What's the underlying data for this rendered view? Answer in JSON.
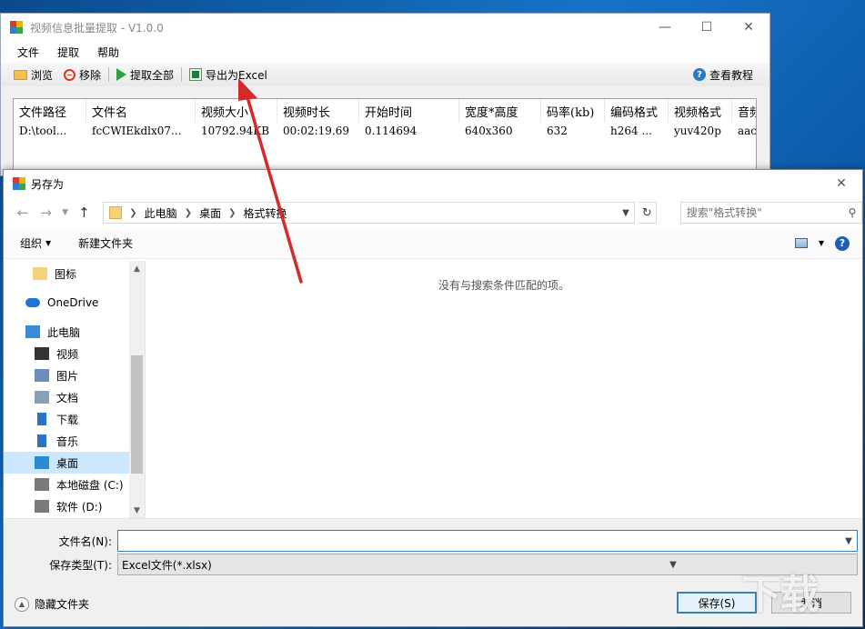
{
  "app": {
    "title": "视频信息批量提取 - V1.0.0",
    "menu": [
      "文件",
      "提取",
      "帮助"
    ],
    "toolbar": {
      "browse": "浏览",
      "remove": "移除",
      "extract_all": "提取全部",
      "export_excel": "导出为Excel",
      "tutorial": "查看教程"
    },
    "grid": {
      "columns": [
        "文件路径",
        "文件名",
        "视频大小",
        "视频时长",
        "开始时间",
        "宽度*高度",
        "码率(kb)",
        "编码格式",
        "视频格式",
        "音频"
      ],
      "rows": [
        [
          "D:\\tool...",
          "fcCWIEkdlx07...",
          "10792.94KB",
          "00:02:19.69",
          "0.114694",
          "640x360",
          "632",
          "h264 ...",
          "yuv420p",
          "aac"
        ]
      ]
    }
  },
  "dialog": {
    "title": "另存为",
    "breadcrumb": [
      "此电脑",
      "桌面",
      "格式转换"
    ],
    "search_placeholder": "搜索\"格式转换\"",
    "organize": "组织",
    "new_folder": "新建文件夹",
    "help": "?",
    "nav_items": [
      {
        "label": "图标",
        "icon": "folder-icon"
      },
      {
        "label": "OneDrive",
        "icon": "cloud-icon"
      },
      {
        "label": "此电脑",
        "icon": "computer-icon"
      },
      {
        "label": "视频",
        "icon": "video-icon"
      },
      {
        "label": "图片",
        "icon": "picture-icon"
      },
      {
        "label": "文档",
        "icon": "document-icon"
      },
      {
        "label": "下载",
        "icon": "download-icon"
      },
      {
        "label": "音乐",
        "icon": "music-icon"
      },
      {
        "label": "桌面",
        "icon": "desktop-icon",
        "selected": true
      },
      {
        "label": "本地磁盘 (C:)",
        "icon": "drive-icon"
      },
      {
        "label": "软件 (D:)",
        "icon": "drive-icon"
      }
    ],
    "empty_message": "没有与搜索条件匹配的项。",
    "filename_label": "文件名(N):",
    "filename_value": "",
    "filetype_label": "保存类型(T):",
    "filetype_value": "Excel文件(*.xlsx)",
    "hide_folders": "隐藏文件夹",
    "save": "保存(S)",
    "cancel": "取消"
  },
  "colors": {
    "accent": "#3c7fb1",
    "selection": "#cce8ff",
    "arrow": "#d42a2a"
  }
}
